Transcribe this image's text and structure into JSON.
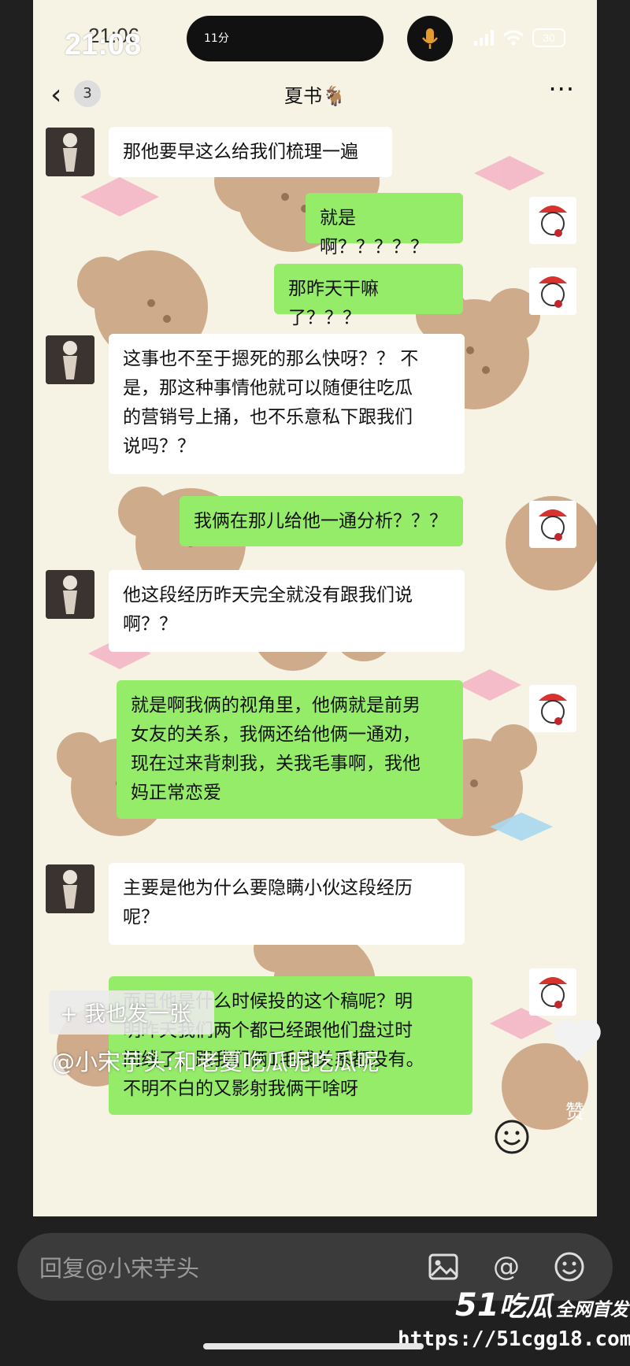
{
  "status_bar": {
    "time_overlay": "21:08",
    "time_underlay": "21:06",
    "island_text": "11分",
    "battery": "30"
  },
  "nav": {
    "back_count": "3",
    "title": "夏书🐐"
  },
  "messages": [
    {
      "side": "left",
      "text": "那他要早这么给我们梳理一遍"
    },
    {
      "side": "right",
      "text": "就是啊？？？？？"
    },
    {
      "side": "right",
      "text": "那昨天干嘛了？？？"
    },
    {
      "side": "left",
      "lines": [
        "这事也不至于摁死的那么快呀？？ 不",
        "是，那这种事情他就可以随便往吃瓜",
        "的营销号上捅，也不乐意私下跟我们",
        "说吗？？"
      ]
    },
    {
      "side": "right",
      "text": "我俩在那儿给他一通分析？？？"
    },
    {
      "side": "left",
      "lines": [
        "他这段经历昨天完全就没有跟我们说",
        "啊？？"
      ]
    },
    {
      "side": "right",
      "lines": [
        "就是啊我俩的视角里，他俩就是前男",
        "女友的关系，我俩还给他俩一通劝，",
        "现在过来背刺我，关我毛事啊，我他",
        "妈正常恋爱"
      ]
    },
    {
      "side": "left",
      "lines": [
        "主要是他为什么要隐瞒小伙这段经历",
        "呢？"
      ]
    },
    {
      "side": "right",
      "lines": [
        "而且他是什么时候投的这个稿呢？明",
        "明昨天我们两个都已经跟他们盘过时",
        "间线了，跟我们俩1毛钱关系都没有。",
        "不明不白的又影射我俩干啥呀"
      ]
    }
  ],
  "post_overlay": {
    "post_button": "+ 我也发一张",
    "caption": "@小宋芋头:和老夏吃瓜呢吃瓜呢",
    "like_label": "赞"
  },
  "reply_bar": {
    "placeholder": "回复@小宋芋头"
  },
  "watermark": {
    "logo_num": "51",
    "logo_text": "吃瓜",
    "slogan": "全网首发",
    "url": "https://51cgg18.com"
  },
  "colors": {
    "bubble_left": "#ffffff",
    "bubble_right": "#95ec69",
    "wallpaper": "#f6f2e4",
    "frame": "#202020",
    "reply_bar": "#3b3b3b"
  }
}
